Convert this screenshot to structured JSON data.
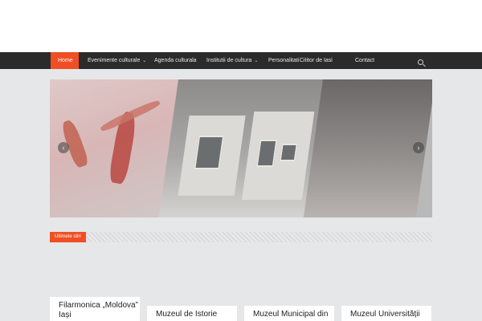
{
  "nav": {
    "items": [
      {
        "label": "Home"
      },
      {
        "label": "Evenimente culturale"
      },
      {
        "label": "Agenda culturala"
      },
      {
        "label": "Institutii de cultura"
      },
      {
        "label": "Personalitati"
      },
      {
        "label": "Cititor de Iasi"
      },
      {
        "label": "Contact"
      }
    ]
  },
  "icons": {
    "search": "search-icon",
    "chevron": "chevron-down-icon",
    "slider_prev": "chevron-left-icon",
    "slider_next": "chevron-right-icon"
  },
  "ticker": {
    "label": "Ultimele stiri"
  },
  "cards": [
    {
      "title": "Filarmonica „Moldova” Iași"
    },
    {
      "title": "Muzeul de Istorie"
    },
    {
      "title": "Muzeul Municipal din"
    },
    {
      "title": "Muzeul Universității"
    }
  ],
  "colors": {
    "accent": "#f04e23",
    "nav_bg": "#2b2b2b",
    "page_bg": "#e6e7e8"
  }
}
